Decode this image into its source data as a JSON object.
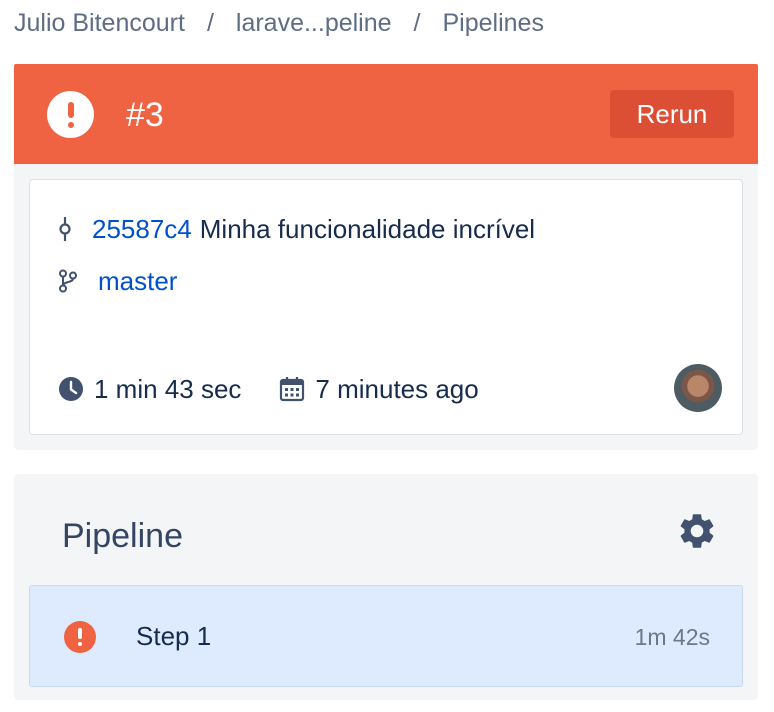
{
  "breadcrumb": {
    "items": [
      "Julio Bitencourt",
      "larave...peline",
      "Pipelines"
    ],
    "separator": "/"
  },
  "header": {
    "status": "failed",
    "status_icon": "exclamation-circle-icon",
    "run_number": "#3",
    "rerun_label": "Rerun",
    "color": "#ef6342"
  },
  "summary": {
    "commit_icon": "commit-icon",
    "commit_hash": "25587c4",
    "commit_message": "Minha funcionalidade incrível",
    "branch_icon": "branch-icon",
    "branch": "master",
    "duration_icon": "clock-icon",
    "duration": "1 min 43 sec",
    "date_icon": "calendar-icon",
    "started": "7 minutes ago",
    "avatar_icon": "user-avatar"
  },
  "pipeline": {
    "title": "Pipeline",
    "settings_icon": "gear-icon",
    "steps": [
      {
        "name": "Step 1",
        "duration": "1m 42s",
        "status": "failed",
        "highlight": "#deebff"
      }
    ]
  }
}
